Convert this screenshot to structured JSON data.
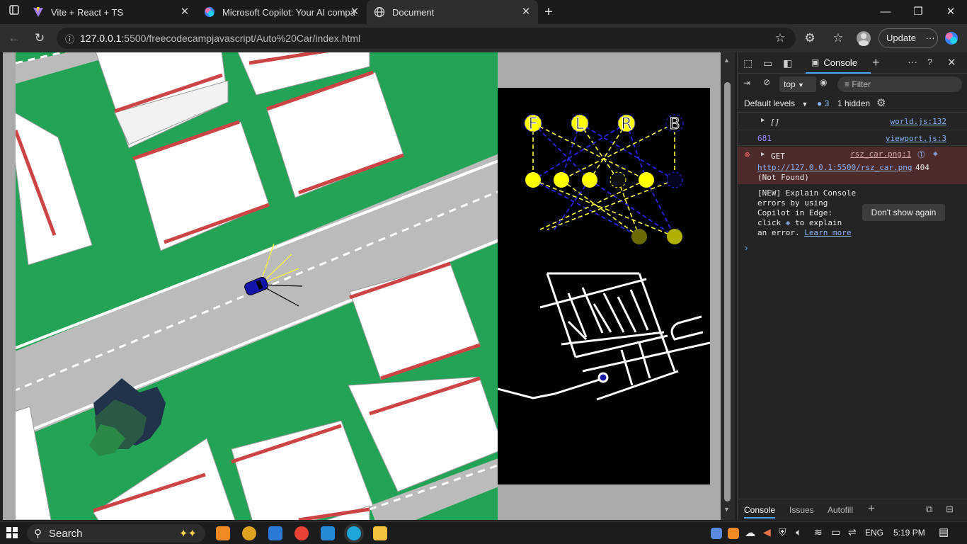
{
  "tabs": [
    {
      "title": "Vite + React + TS",
      "active": false
    },
    {
      "title": "Microsoft Copilot: Your AI compa",
      "active": false
    },
    {
      "title": "Document",
      "active": true
    }
  ],
  "address": {
    "host": "127.0.0.1",
    "path": ":5500/freecodecampjavascript/Auto%20Car/index.html"
  },
  "update_label": "Update",
  "viz": {
    "sensor_labels": [
      "F",
      "L",
      "R",
      "B"
    ]
  },
  "devtools": {
    "tab_console": "Console",
    "context": "top",
    "filter_placeholder": "Filter",
    "levels": "Default levels",
    "issue_count": "3",
    "hidden": "1 hidden",
    "logs": {
      "arr_value": "[]",
      "arr_src": "world.js:132",
      "num_value": "681",
      "num_src": "viewport.js:3",
      "err_method": "GET",
      "err_src": "rsz_car.png:1",
      "err_url": "http://127.0.0.1:5500/rsz_car.png",
      "err_status": "404",
      "err_reason": "(Not Found)"
    },
    "tip_line1": "[NEW] Explain Console",
    "tip_line2": "errors by using",
    "tip_line3": "Copilot in Edge:",
    "tip_line4_a": "click",
    "tip_line4_b": "to explain",
    "tip_line5_a": "an error.",
    "tip_learn": "Learn more",
    "dont_show": "Don't show again",
    "drawer_tabs": [
      "Console",
      "Issues",
      "Autofill"
    ]
  },
  "taskbar": {
    "search": "Search",
    "lang": "ENG",
    "time": "5:19 PM"
  },
  "colors": {
    "grass": "#22a355",
    "road": "#bbbbbb",
    "neuron": "#ffff00",
    "accent": "#8ab4f8"
  }
}
